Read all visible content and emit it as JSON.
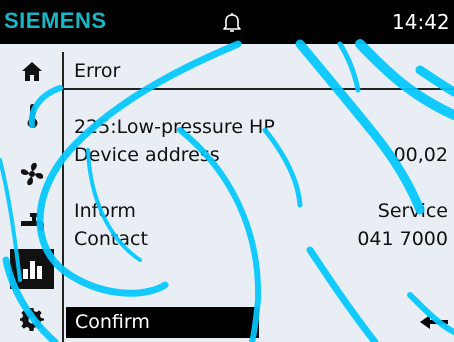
{
  "header": {
    "brand": "SIEMENS",
    "time": "14:42",
    "brand_color": "#19b7c4"
  },
  "nav": {
    "items": [
      {
        "name": "home",
        "icon": "home-icon"
      },
      {
        "name": "temperature",
        "icon": "thermometer-icon"
      },
      {
        "name": "ventilation",
        "icon": "fan-icon"
      },
      {
        "name": "hot-water",
        "icon": "faucet-icon"
      },
      {
        "name": "reports",
        "icon": "bar-chart-icon",
        "active": true
      },
      {
        "name": "settings",
        "icon": "gear-icon"
      }
    ]
  },
  "main": {
    "title": "Error",
    "error_code": "225:Low-pressure HP",
    "device_address_label": "Device address",
    "device_address_value": "00,02",
    "inform_label": "Inform",
    "inform_value": "Service",
    "contact_label": "Contact",
    "contact_value": "041 7000",
    "confirm_label": "Confirm"
  },
  "colors": {
    "background": "#e8eef4",
    "overlay": "#00c8ff"
  }
}
